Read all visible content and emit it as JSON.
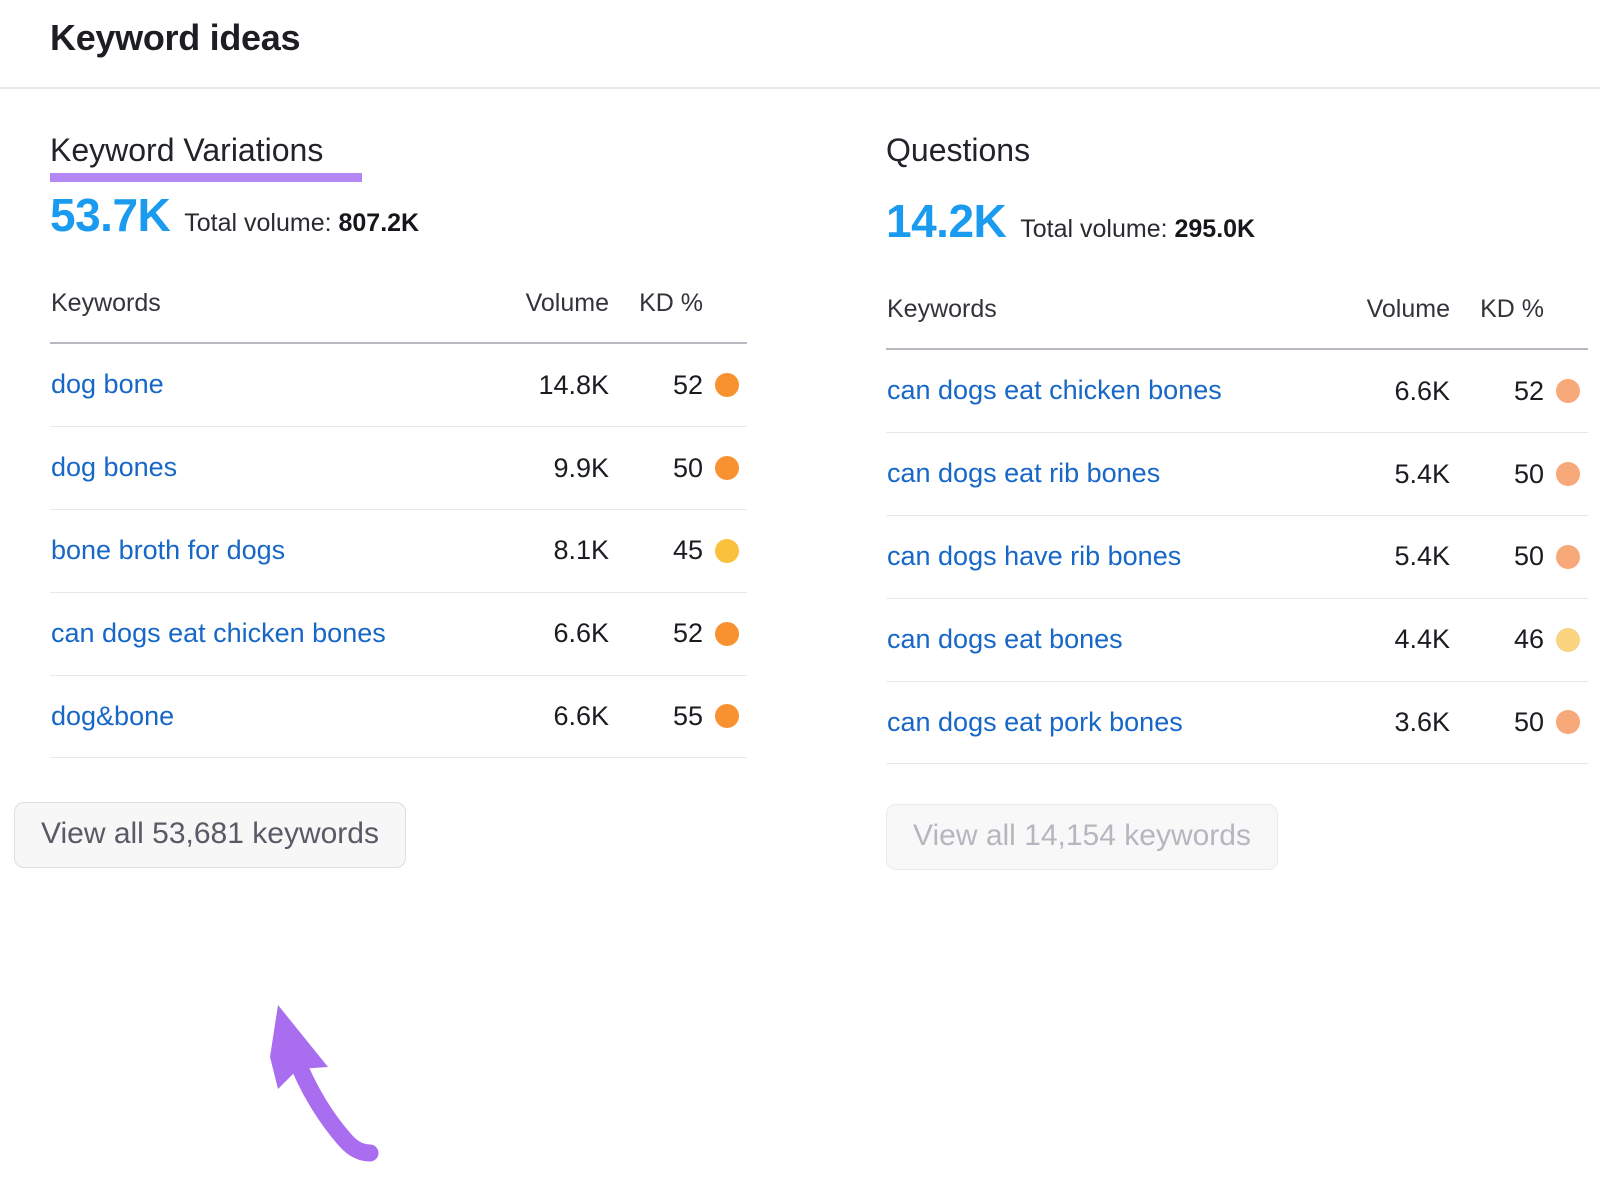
{
  "header": {
    "title": "Keyword ideas"
  },
  "colors": {
    "accent_blue": "#1a9bf0",
    "link_blue": "#1667c7",
    "underline_purple": "#b388f5",
    "kd_orange": "#f8912f",
    "kd_yellow": "#f9c13c",
    "kd_orange_light": "#f7a97a",
    "kd_yellow_light": "#fbd27e"
  },
  "panels": [
    {
      "id": "keyword-variations",
      "heading": "Keyword Variations",
      "has_underline": true,
      "count": "53.7K",
      "total_volume_label": "Total volume:",
      "total_volume_value": "807.2K",
      "columns": [
        "Keywords",
        "Volume",
        "KD %"
      ],
      "rows": [
        {
          "keyword": "dog bone",
          "volume": "14.8K",
          "kd": "52",
          "dot": "#f8912f"
        },
        {
          "keyword": "dog bones",
          "volume": "9.9K",
          "kd": "50",
          "dot": "#f8912f"
        },
        {
          "keyword": "bone broth for dogs",
          "volume": "8.1K",
          "kd": "45",
          "dot": "#f9c13c"
        },
        {
          "keyword": "can dogs eat chicken bones",
          "volume": "6.6K",
          "kd": "52",
          "dot": "#f8912f"
        },
        {
          "keyword": "dog&bone",
          "volume": "6.6K",
          "kd": "55",
          "dot": "#f8912f"
        }
      ],
      "view_all_label": "View all 53,681 keywords",
      "view_all_faded": false
    },
    {
      "id": "questions",
      "heading": "Questions",
      "has_underline": false,
      "count": "14.2K",
      "total_volume_label": "Total volume:",
      "total_volume_value": "295.0K",
      "columns": [
        "Keywords",
        "Volume",
        "KD %"
      ],
      "rows": [
        {
          "keyword": "can dogs eat chicken bones",
          "volume": "6.6K",
          "kd": "52",
          "dot": "#f7a97a"
        },
        {
          "keyword": "can dogs eat rib bones",
          "volume": "5.4K",
          "kd": "50",
          "dot": "#f7a97a"
        },
        {
          "keyword": "can dogs have rib bones",
          "volume": "5.4K",
          "kd": "50",
          "dot": "#f7a97a"
        },
        {
          "keyword": "can dogs eat bones",
          "volume": "4.4K",
          "kd": "46",
          "dot": "#fbd27e"
        },
        {
          "keyword": "can dogs eat pork bones",
          "volume": "3.6K",
          "kd": "50",
          "dot": "#f7a97a"
        }
      ],
      "view_all_label": "View all 14,154 keywords",
      "view_all_faded": true
    }
  ],
  "annotation": {
    "arrow_color": "#a96ef0",
    "points_to": "View all 53,681 keywords"
  }
}
